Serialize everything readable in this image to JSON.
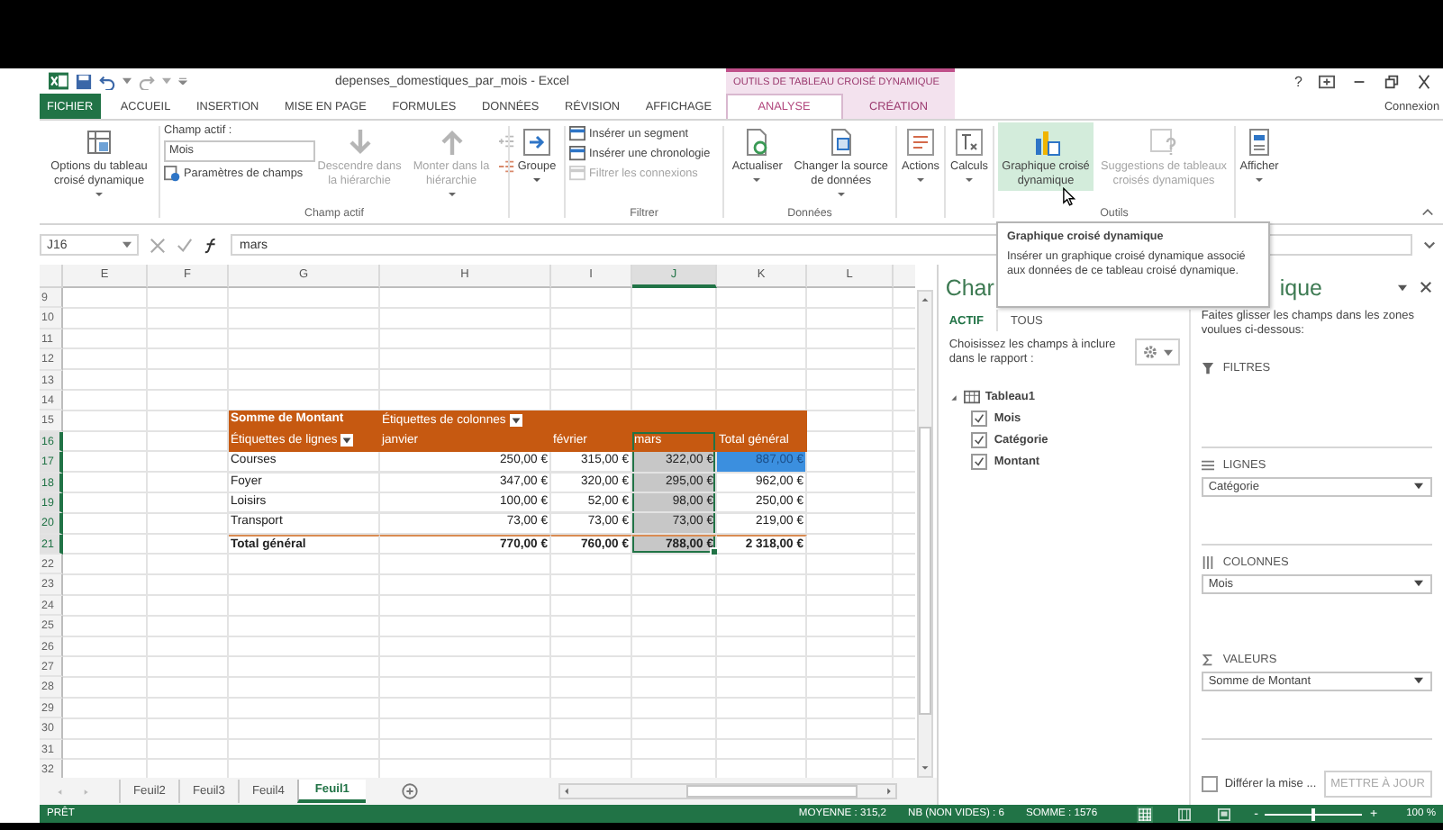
{
  "window": {
    "title": "depenses_domestiques_par_mois - Excel",
    "context_label": "OUTILS DE TABLEAU CROISÉ DYNAMIQUE",
    "help": "?",
    "account": "Connexion"
  },
  "tabs": [
    {
      "label": "FICHIER",
      "kind": "file",
      "selected": false
    },
    {
      "label": "ACCUEIL",
      "kind": "normal",
      "selected": false
    },
    {
      "label": "INSERTION",
      "kind": "normal",
      "selected": false
    },
    {
      "label": "MISE EN PAGE",
      "kind": "normal",
      "selected": false
    },
    {
      "label": "FORMULES",
      "kind": "normal",
      "selected": false
    },
    {
      "label": "DONNÉES",
      "kind": "normal",
      "selected": false
    },
    {
      "label": "RÉVISION",
      "kind": "normal",
      "selected": false
    },
    {
      "label": "AFFICHAGE",
      "kind": "normal",
      "selected": false
    },
    {
      "label": "ANALYSE",
      "kind": "context",
      "selected": true
    },
    {
      "label": "CRÉATION",
      "kind": "context",
      "selected": false
    }
  ],
  "ribbon": {
    "options_button": {
      "label": "Options du tableau\ncroisé dynamique",
      "dropdown": true
    },
    "active_field": {
      "group_label": "Champ actif",
      "field_label": "Champ actif :",
      "field_value": "Mois",
      "settings_button": "Paramètres de champs",
      "drill_down": {
        "label": "Descendre dans\nla hiérarchie",
        "disabled": true,
        "dropdown": false
      },
      "drill_up": {
        "label": "Monter dans la\nhiérarchie",
        "disabled": true,
        "dropdown": true
      }
    },
    "group_button": {
      "label": "Groupe",
      "dropdown": true
    },
    "filter": {
      "group_label": "Filtrer",
      "items": [
        {
          "label": "Insérer un segment",
          "disabled": false
        },
        {
          "label": "Insérer une chronologie",
          "disabled": false
        },
        {
          "label": "Filtrer les connexions",
          "disabled": true
        }
      ]
    },
    "data": {
      "group_label": "Données",
      "items": [
        {
          "label": "Actualiser",
          "dropdown": true
        },
        {
          "label": "Changer la source\nde données",
          "dropdown": true
        }
      ]
    },
    "actions_button": {
      "label": "Actions",
      "dropdown": true
    },
    "calculations_button": {
      "label": "Calculs",
      "dropdown": true
    },
    "tools": {
      "group_label": "Outils",
      "items": [
        {
          "label": "Graphique croisé\ndynamique",
          "hovered": true,
          "disabled": false
        },
        {
          "label": "Suggestions de tableaux\ncroisés dynamiques",
          "hovered": false,
          "disabled": true
        }
      ]
    },
    "show_button": {
      "label": "Afficher",
      "dropdown": true
    }
  },
  "formula_bar": {
    "name_box": "J16",
    "formula": "mars"
  },
  "sheet": {
    "columns": [
      {
        "label": "E",
        "selected": false
      },
      {
        "label": "F",
        "selected": false
      },
      {
        "label": "G",
        "selected": false
      },
      {
        "label": "H",
        "selected": false
      },
      {
        "label": "I",
        "selected": false
      },
      {
        "label": "J",
        "selected": true
      },
      {
        "label": "K",
        "selected": false
      },
      {
        "label": "L",
        "selected": false
      }
    ],
    "rows": [
      {
        "label": "9",
        "selected": false
      },
      {
        "label": "10",
        "selected": false
      },
      {
        "label": "11",
        "selected": false
      },
      {
        "label": "12",
        "selected": false
      },
      {
        "label": "13",
        "selected": false
      },
      {
        "label": "14",
        "selected": false
      },
      {
        "label": "15",
        "selected": false
      },
      {
        "label": "16",
        "selected": true
      },
      {
        "label": "17",
        "selected": true
      },
      {
        "label": "18",
        "selected": true
      },
      {
        "label": "19",
        "selected": true
      },
      {
        "label": "20",
        "selected": true
      },
      {
        "label": "21",
        "selected": true
      },
      {
        "label": "22",
        "selected": false
      },
      {
        "label": "23",
        "selected": false
      },
      {
        "label": "24",
        "selected": false
      },
      {
        "label": "25",
        "selected": false
      },
      {
        "label": "26",
        "selected": false
      },
      {
        "label": "27",
        "selected": false
      },
      {
        "label": "28",
        "selected": false
      },
      {
        "label": "29",
        "selected": false
      },
      {
        "label": "30",
        "selected": false
      },
      {
        "label": "31",
        "selected": false
      },
      {
        "label": "32",
        "selected": false
      }
    ]
  },
  "pivot": {
    "value_field": "Somme de Montant",
    "column_labels": "Étiquettes de colonnes",
    "row_labels": "Étiquettes de lignes",
    "columns": [
      {
        "label": "janvier",
        "selected": false
      },
      {
        "label": "février",
        "selected": false
      },
      {
        "label": "mars",
        "selected": true
      },
      {
        "label": "Total général",
        "selected": false
      }
    ],
    "rows": [
      {
        "label": "Courses",
        "values": [
          "250,00 €",
          "315,00 €",
          "322,00 €",
          "887,00 €"
        ],
        "total_highlighted": true
      },
      {
        "label": "Foyer",
        "values": [
          "347,00 €",
          "320,00 €",
          "295,00 €",
          "962,00 €"
        ],
        "total_highlighted": false
      },
      {
        "label": "Loisirs",
        "values": [
          "100,00 €",
          "52,00 €",
          "98,00 €",
          "250,00 €"
        ],
        "total_highlighted": false
      },
      {
        "label": "Transport",
        "values": [
          "73,00 €",
          "73,00 €",
          "73,00 €",
          "219,00 €"
        ],
        "total_highlighted": false
      }
    ],
    "grand_total": {
      "label": "Total général",
      "values": [
        "770,00 €",
        "760,00 €",
        "788,00 €",
        "2 318,00 €"
      ]
    }
  },
  "sheet_tabs": [
    {
      "label": "Feuil2",
      "selected": false
    },
    {
      "label": "Feuil3",
      "selected": false
    },
    {
      "label": "Feuil4",
      "selected": false
    },
    {
      "label": "Feuil1",
      "selected": true
    }
  ],
  "tooltip": {
    "title": "Graphique croisé dynamique",
    "text": "Insérer un graphique croisé dynamique associé aux données de ce tableau croisé dynamique."
  },
  "field_pane": {
    "title_start": "Char",
    "title_end": "ique",
    "tabs": [
      {
        "label": "ACTIF",
        "selected": true
      },
      {
        "label": "TOUS",
        "selected": false
      }
    ],
    "instructions": "Choisissez les champs à inclure dans le rapport :",
    "table": {
      "label": "Tableau1",
      "expanded": true,
      "children": [
        {
          "label": "Mois",
          "checked": true
        },
        {
          "label": "Catégorie",
          "checked": true
        },
        {
          "label": "Montant",
          "checked": true
        }
      ]
    },
    "drag_hint": "Faites glisser les champs dans les zones voulues ci-dessous:",
    "areas": [
      {
        "kind": "filters",
        "label": "FILTRES"
      },
      {
        "kind": "rows",
        "label": "LIGNES",
        "items": [
          {
            "label": "Catégorie"
          }
        ]
      },
      {
        "kind": "columns",
        "label": "COLONNES",
        "items": [
          {
            "label": "Mois"
          }
        ]
      },
      {
        "kind": "values",
        "label": "VALEURS",
        "items": [
          {
            "label": "Somme de Montant"
          }
        ]
      }
    ],
    "defer": {
      "label": "Différer la mise ...",
      "checked": false
    },
    "update_button": {
      "label": "METTRE À JOUR",
      "disabled": true
    }
  },
  "status_bar": {
    "mode": "PRÊT",
    "average": "MOYENNE : 315,2",
    "count": "NB (NON VIDES) : 6",
    "sum": "SOMME : 1576",
    "views": [
      {
        "selected": true
      },
      {
        "selected": false
      },
      {
        "selected": false
      }
    ],
    "zoom": {
      "minus": "-",
      "plus": "+",
      "level": 0.5,
      "value": "100 %"
    }
  }
}
